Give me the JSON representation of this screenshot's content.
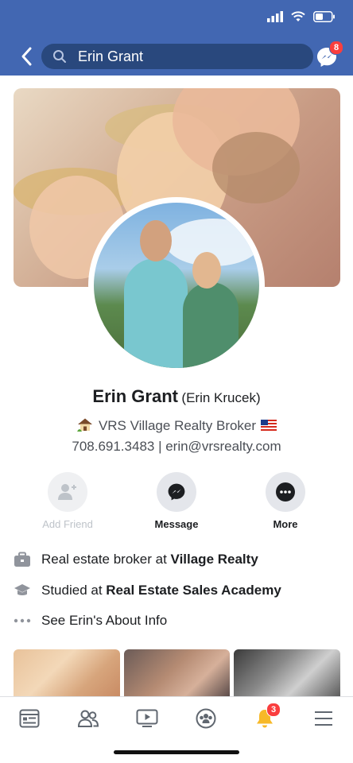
{
  "header": {
    "search_value": "Erin Grant",
    "messenger_badge": "8"
  },
  "profile": {
    "name": "Erin Grant",
    "alternate_name": "(Erin Krucek)",
    "bio_line1": "VRS Village Realty Broker",
    "bio_line2": "708.691.3483 | erin@vrsrealty.com"
  },
  "actions": [
    {
      "label": "Add Friend",
      "enabled": false
    },
    {
      "label": "Message",
      "enabled": true
    },
    {
      "label": "More",
      "enabled": true
    }
  ],
  "intro": {
    "work_prefix": "Real estate broker at ",
    "work_place": "Village Realty",
    "education_prefix": "Studied at ",
    "education_place": "Real Estate Sales Academy",
    "about_link": "See Erin's About Info"
  },
  "bottom_nav": {
    "notifications_badge": "3"
  },
  "colors": {
    "header_bg": "#4267b2",
    "badge_red": "#fa3e3e"
  }
}
